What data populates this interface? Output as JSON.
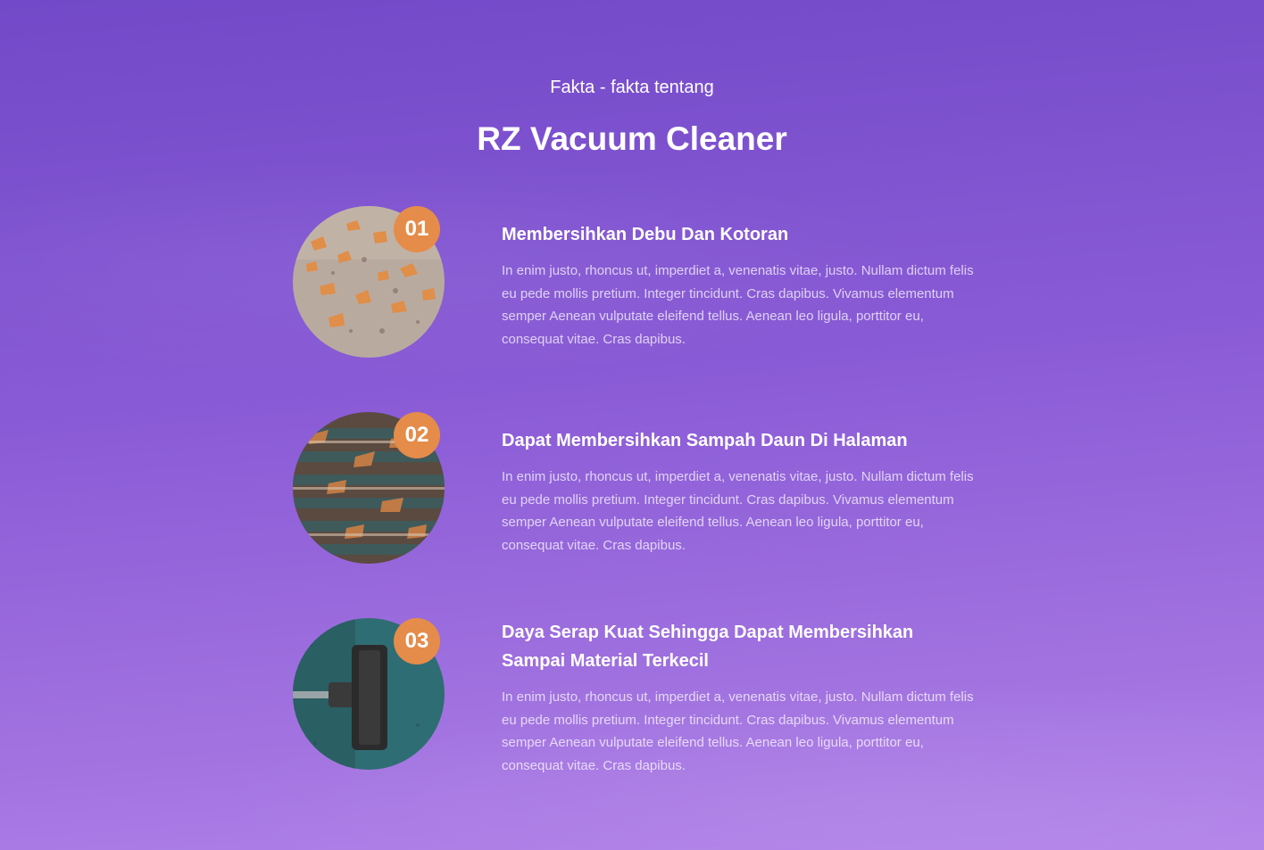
{
  "header": {
    "subtitle": "Fakta - fakta tentang",
    "title": "RZ Vacuum Cleaner"
  },
  "facts": [
    {
      "number": "01",
      "title": "Membersihkan Debu Dan Kotoran",
      "description": "In enim justo, rhoncus ut, imperdiet a, venenatis vitae, justo. Nullam dictum felis eu pede mollis pretium. Integer tincidunt. Cras dapibus. Vivamus elementum semper Aenean vulputate eleifend tellus. Aenean leo ligula, porttitor eu, consequat vitae. Cras dapibus.",
      "image": "dirt-on-floor-photo"
    },
    {
      "number": "02",
      "title": "Dapat Membersihkan Sampah Daun Di Halaman",
      "description": "In enim justo, rhoncus ut, imperdiet a, venenatis vitae, justo. Nullam dictum felis eu pede mollis pretium. Integer tincidunt. Cras dapibus. Vivamus elementum semper Aenean vulputate eleifend tellus. Aenean leo ligula, porttitor eu, consequat vitae. Cras dapibus.",
      "image": "leaves-on-deck-photo"
    },
    {
      "number": "03",
      "title": "Daya Serap Kuat Sehingga Dapat Membersihkan Sampai Material Terkecil",
      "description": "In enim justo, rhoncus ut, imperdiet a, venenatis vitae, justo. Nullam dictum felis eu pede mollis pretium. Integer tincidunt. Cras dapibus. Vivamus elementum semper Aenean vulputate eleifend tellus. Aenean leo ligula, porttitor eu, consequat vitae. Cras dapibus.",
      "image": "vacuum-head-on-carpet-photo"
    }
  ],
  "colors": {
    "background_top": "#7249c8",
    "background_bottom": "#b384ea",
    "badge": "#e58c4a",
    "text": "#ffffff"
  }
}
